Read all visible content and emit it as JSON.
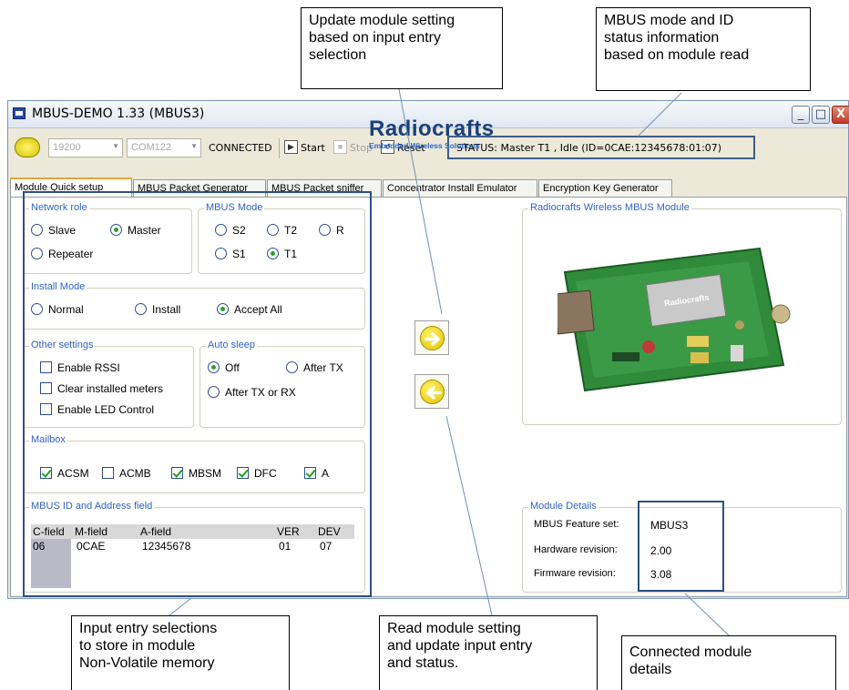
{
  "callouts": {
    "update_setting": [
      "Update module setting",
      "based on input entry",
      "selection"
    ],
    "mbus_status": [
      "MBUS mode and ID",
      "status information",
      "based on module read"
    ],
    "input_entry": [
      "Input entry selections",
      "to store in  module",
      "Non-Volatile memory"
    ],
    "read_setting": [
      "Read module setting",
      "and update input entry",
      "and status."
    ],
    "connected_details": [
      "Connected module",
      "details"
    ]
  },
  "window": {
    "title": "MBUS-DEMO 1.33 (MBUS3)",
    "controls": [
      "_",
      "□",
      "X"
    ]
  },
  "toolbar": {
    "baud": "19200",
    "port": "COM122",
    "connection": "CONNECTED",
    "start": "Start",
    "stop": "Stop",
    "reset": "Reset",
    "status": "STATUS: Master T1 , Idle  (ID=0CAE:12345678:01:07)"
  },
  "tabs": [
    "Module Quick setup",
    "MBUS Packet Generator",
    "MBUS Packet sniffer",
    "Concentrator Install Emulator",
    "Encryption Key Generator"
  ],
  "network_role": {
    "legend": "Network role",
    "options": [
      "Slave",
      "Master",
      "Repeater"
    ],
    "selected": "Master"
  },
  "mbus_mode": {
    "legend": "MBUS Mode",
    "options": [
      "S2",
      "T2",
      "R",
      "S1",
      "T1"
    ],
    "selected": "T1"
  },
  "install_mode": {
    "legend": "Install Mode",
    "options": [
      "Normal",
      "Install",
      "Accept All"
    ],
    "selected": "Accept All"
  },
  "other_settings": {
    "legend": "Other settings",
    "options": [
      "Enable RSSI",
      "Clear installed meters",
      "Enable LED Control"
    ],
    "checked": [
      false,
      false,
      false
    ]
  },
  "auto_sleep": {
    "legend": "Auto sleep",
    "options": [
      "Off",
      "After TX",
      "After TX or RX"
    ],
    "selected": "Off"
  },
  "mailbox": {
    "legend": "Mailbox",
    "options": [
      "ACSM",
      "ACMB",
      "MBSM",
      "DFC",
      "A"
    ],
    "checked": [
      true,
      false,
      true,
      true,
      true
    ]
  },
  "mbus_id": {
    "legend": "MBUS ID and Address field",
    "headers": [
      "C-field",
      "M-field",
      "A-field",
      "VER",
      "DEV"
    ],
    "values": [
      "06",
      "0CAE",
      "12345678",
      "01",
      "07"
    ]
  },
  "logo": {
    "name": "Radiocrafts",
    "tagline": "Embedded Wireless Solutions"
  },
  "module_image": {
    "legend": "Radiocrafts Wireless MBUS Module",
    "chip_label": "Radiocrafts"
  },
  "module_details": {
    "legend": "Module Details",
    "rows": [
      {
        "label": "MBUS Feature set:",
        "value": "MBUS3"
      },
      {
        "label": "Hardware revision:",
        "value": "2.00"
      },
      {
        "label": "Firmware revision:",
        "value": "3.08"
      }
    ]
  },
  "colors": {
    "group_legend": "#3262c4",
    "highlight_box": "#2e4f83",
    "button_yellow": "#fff36a",
    "pcb_green": "#2f8a3a"
  }
}
